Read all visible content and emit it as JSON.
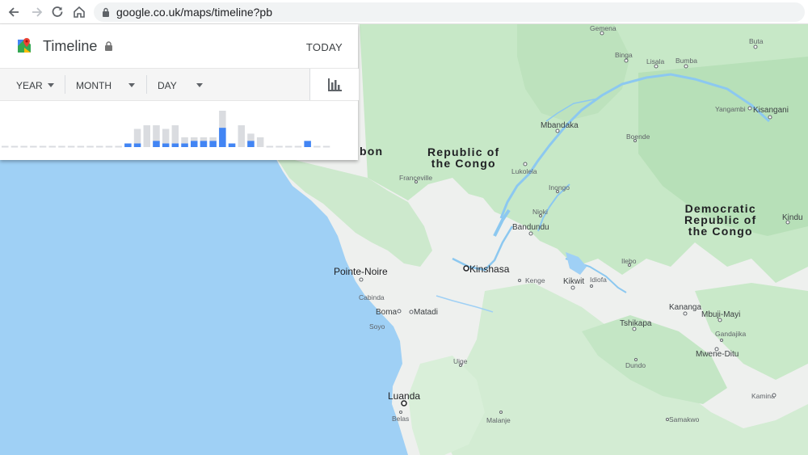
{
  "browser": {
    "url": "google.co.uk/maps/timeline?pb"
  },
  "timeline": {
    "title": "Timeline",
    "today_label": "TODAY",
    "year_label": "YEAR",
    "month_label": "MONTH",
    "day_label": "DAY",
    "accent_color": "#4285f4",
    "inactive_color": "#dadce0",
    "histogram_counts": [
      {
        "total": 0,
        "active": 0
      },
      {
        "total": 0,
        "active": 0
      },
      {
        "total": 0,
        "active": 0
      },
      {
        "total": 0,
        "active": 0
      },
      {
        "total": 0,
        "active": 0
      },
      {
        "total": 0,
        "active": 0
      },
      {
        "total": 0,
        "active": 0
      },
      {
        "total": 0,
        "active": 0
      },
      {
        "total": 0,
        "active": 0
      },
      {
        "total": 0,
        "active": 0
      },
      {
        "total": 0,
        "active": 0
      },
      {
        "total": 0,
        "active": 0
      },
      {
        "total": 0,
        "active": 0
      },
      {
        "total": 0.1,
        "active": 0.1
      },
      {
        "total": 0.5,
        "active": 0.1
      },
      {
        "total": 0.6,
        "active": 0
      },
      {
        "total": 0.6,
        "active": 0.17
      },
      {
        "total": 0.5,
        "active": 0.1
      },
      {
        "total": 0.6,
        "active": 0.1
      },
      {
        "total": 0.27,
        "active": 0.1
      },
      {
        "total": 0.27,
        "active": 0.17
      },
      {
        "total": 0.27,
        "active": 0.17
      },
      {
        "total": 0.27,
        "active": 0.17
      },
      {
        "total": 1.0,
        "active": 0.53
      },
      {
        "total": 0.1,
        "active": 0.1
      },
      {
        "total": 0.6,
        "active": 0
      },
      {
        "total": 0.37,
        "active": 0.17
      },
      {
        "total": 0.27,
        "active": 0
      },
      {
        "total": 0,
        "active": 0
      },
      {
        "total": 0,
        "active": 0
      },
      {
        "total": 0,
        "active": 0
      },
      {
        "total": 0,
        "active": 0
      },
      {
        "total": 0,
        "active": 0.17
      },
      {
        "total": 0,
        "active": 0
      },
      {
        "total": 0,
        "active": 0
      }
    ]
  },
  "map": {
    "countries": [
      {
        "name_lines": [
          "Republic of",
          "the Congo"
        ],
        "key": "republic-of-the-congo"
      },
      {
        "name_lines": [
          "Democratic",
          "Republic of",
          "the Congo"
        ],
        "key": "drc"
      },
      {
        "name_lines": [
          "bon"
        ],
        "key": "gabon"
      }
    ],
    "places": [
      {
        "name": "Gemena",
        "style": "small"
      },
      {
        "name": "Buta",
        "style": "small"
      },
      {
        "name": "Binga",
        "style": "small"
      },
      {
        "name": "Lisala",
        "style": "small"
      },
      {
        "name": "Bumba",
        "style": "small"
      },
      {
        "name": "Yangambi",
        "style": "small"
      },
      {
        "name": "Kisangani",
        "style": "city"
      },
      {
        "name": "Mbandaka",
        "style": "city"
      },
      {
        "name": "Boende",
        "style": "small"
      },
      {
        "name": "Franceville",
        "style": "small"
      },
      {
        "name": "Lukolela",
        "style": "small"
      },
      {
        "name": "Inongo",
        "style": "small"
      },
      {
        "name": "Nioki",
        "style": "small"
      },
      {
        "name": "Kindu",
        "style": "city"
      },
      {
        "name": "Bandundu",
        "style": "city"
      },
      {
        "name": "Ilebo",
        "style": "small"
      },
      {
        "name": "Pointe-Noire",
        "style": "big"
      },
      {
        "name": "Kinshasa",
        "style": "big"
      },
      {
        "name": "Kenge",
        "style": "small"
      },
      {
        "name": "Kikwit",
        "style": "city"
      },
      {
        "name": "Idiofa",
        "style": "small"
      },
      {
        "name": "Cabinda",
        "style": "small"
      },
      {
        "name": "Boma",
        "style": "city"
      },
      {
        "name": "Matadi",
        "style": "city"
      },
      {
        "name": "Kananga",
        "style": "city"
      },
      {
        "name": "Mbuji-Mayi",
        "style": "city"
      },
      {
        "name": "Soyo",
        "style": "small"
      },
      {
        "name": "Tshikapa",
        "style": "city"
      },
      {
        "name": "Gandajika",
        "style": "small"
      },
      {
        "name": "Mwene-Ditu",
        "style": "city"
      },
      {
        "name": "Uige",
        "style": "small"
      },
      {
        "name": "Dundo",
        "style": "small"
      },
      {
        "name": "Luanda",
        "style": "big"
      },
      {
        "name": "Kamina",
        "style": "small"
      },
      {
        "name": "Belas",
        "style": "small"
      },
      {
        "name": "Malanje",
        "style": "small"
      },
      {
        "name": "Samakwo",
        "style": "small"
      }
    ]
  }
}
